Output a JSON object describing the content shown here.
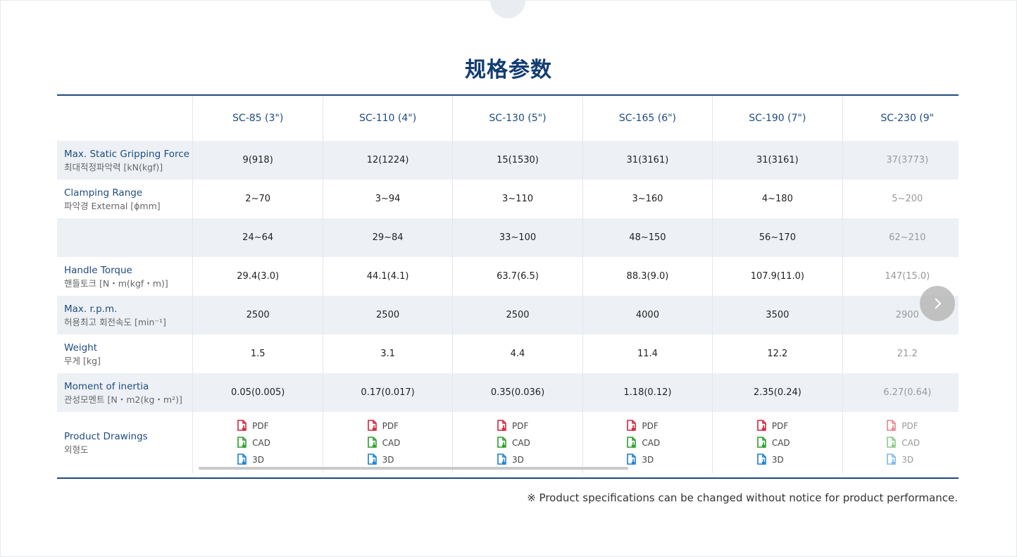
{
  "title": "规格参数",
  "columns": [
    "SC-85 (3\")",
    "SC-110 (4\")",
    "SC-130 (5\")",
    "SC-165 (6\")",
    "SC-190 (7\")",
    "SC-230 (9\""
  ],
  "rows": [
    {
      "en": "Max. Static Gripping Force",
      "ko": "최대적정파악력 [kN(kgf)]",
      "values": [
        "9(918)",
        "12(1224)",
        "15(1530)",
        "31(3161)",
        "31(3161)",
        "37(3773)"
      ]
    },
    {
      "en": "Clamping Range",
      "ko": "파악경 External [ϕmm]",
      "values": [
        "2~70",
        "3~94",
        "3~110",
        "3~160",
        "4~180",
        "5~200"
      ]
    },
    {
      "en": "",
      "ko": "",
      "values": [
        "24~64",
        "29~84",
        "33~100",
        "48~150",
        "56~170",
        "62~210"
      ]
    },
    {
      "en": "Handle Torque",
      "ko": "핸들토크 [N・m(kgf・m)]",
      "values": [
        "29.4(3.0)",
        "44.1(4.1)",
        "63.7(6.5)",
        "88.3(9.0)",
        "107.9(11.0)",
        "147(15.0)"
      ]
    },
    {
      "en": "Max. r.p.m.",
      "ko": "허용최고 회전속도 [min⁻¹]",
      "values": [
        "2500",
        "2500",
        "2500",
        "4000",
        "3500",
        "2900"
      ]
    },
    {
      "en": "Weight",
      "ko": "무게 [kg]",
      "values": [
        "1.5",
        "3.1",
        "4.4",
        "11.4",
        "12.2",
        "21.2"
      ]
    },
    {
      "en": "Moment of inertia",
      "ko": "관성모멘트 [N・m2(kg・m²)]",
      "values": [
        "0.05(0.005)",
        "0.17(0.017)",
        "0.35(0.036)",
        "1.18(0.12)",
        "2.35(0.24)",
        "6.27(0.64)"
      ]
    }
  ],
  "drawings": {
    "en": "Product Drawings",
    "ko": "외형도",
    "pdf": "PDF",
    "cad": "CAD",
    "d3": "3D"
  },
  "colors": {
    "pdf": "#d0243c",
    "cad": "#2a9d2a",
    "d3": "#1a7fd4",
    "accent": "#1f4b80"
  },
  "note": "※ Product specifications can be changed without notice for product performance."
}
